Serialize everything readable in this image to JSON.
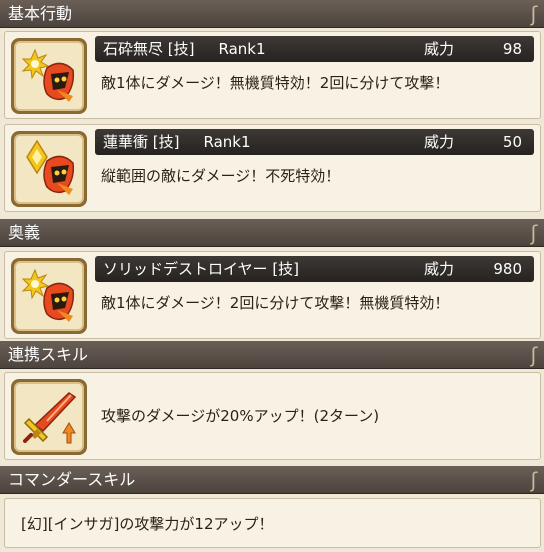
{
  "sections": {
    "basic": "基本行動",
    "ougi": "奥義",
    "renkei": "連携スキル",
    "commander": "コマンダースキル"
  },
  "flourish_glyph": "ʃ",
  "skills": [
    {
      "name": "石砕無尽 [技]",
      "rank": "Rank1",
      "power_label": "威力",
      "power_value": "98",
      "description": "敵1体にダメージ！無機質特効！2回に分けて攻撃！",
      "icon": "starburst-mask-icon"
    },
    {
      "name": "蓮華衝 [技]",
      "rank": "Rank1",
      "power_label": "威力",
      "power_value": "50",
      "description": "縦範囲の敵にダメージ！不死特効！",
      "icon": "diamond-mask-icon"
    },
    {
      "name": "ソリッドデストロイヤー [技]",
      "rank": "",
      "power_label": "威力",
      "power_value": "980",
      "description": "敵1体にダメージ！2回に分けて攻撃！無機質特効！",
      "icon": "starburst-mask-icon"
    }
  ],
  "renkei": {
    "description": "攻撃のダメージが20%アップ！(2ターン)",
    "icon": "sword-up-icon"
  },
  "commander": {
    "description": "[幻][インサガ]の攻撃力が12アップ！"
  },
  "colors": {
    "header_bg": "#554b44",
    "card_bg": "#f8f2e4",
    "bar_bg": "#2e2a27",
    "icon_frame": "#8a6a32",
    "icon_fill": "#f3e6c3",
    "accent_red": "#d23a22",
    "accent_orange": "#f08a1e",
    "accent_yellow": "#f2c61e"
  }
}
